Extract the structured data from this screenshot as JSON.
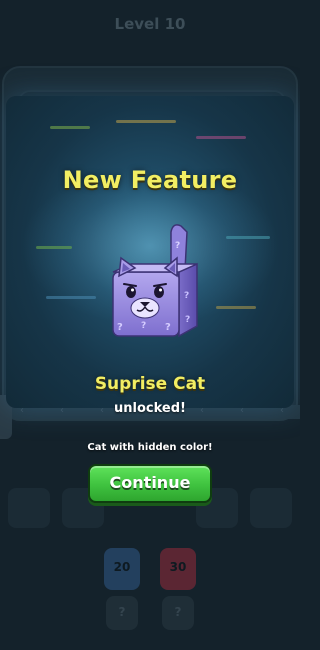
{
  "background": {
    "level_label": "Level 10",
    "price_cards": [
      {
        "value": "20",
        "color": "#3e6fa8"
      },
      {
        "value": "30",
        "color": "#b04a5e"
      }
    ],
    "locked_labels": [
      "?",
      "?"
    ]
  },
  "popup": {
    "title": "New Feature",
    "feature_name": "Suprise Cat",
    "status": "unlocked!",
    "description": "Cat with hidden color!",
    "continue_label": "Continue"
  },
  "colors": {
    "title_yellow": "#f2ee63",
    "button_green": "#3fc23f",
    "cat_purple": "#9c8fe0"
  }
}
